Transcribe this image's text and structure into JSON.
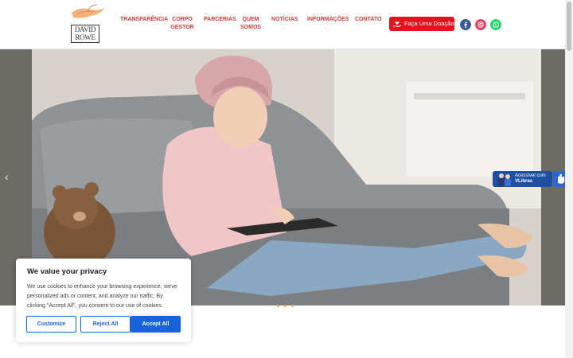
{
  "logo": {
    "line1": "DAVID",
    "line2": "ROWE"
  },
  "nav": [
    {
      "label": "TRANSPARÊNCIA",
      "dot": ""
    },
    {
      "label": "CORPO\nGESTOR",
      "dot": ""
    },
    {
      "label": "PARCERIAS",
      "dot": ""
    },
    {
      "label": "QUEM\nSOMOS",
      "dot": ""
    },
    {
      "label": "NOTÍCIAS",
      "dot": "."
    },
    {
      "label": "INFORMAÇÕES",
      "dot": "."
    },
    {
      "label": "CONTATO",
      "dot": ""
    }
  ],
  "donate": {
    "label": "Faça Uma Doação"
  },
  "social": [
    {
      "icon": "facebook-icon",
      "color": "#3b5998"
    },
    {
      "icon": "instagram-icon",
      "color": "#e4405f"
    },
    {
      "icon": "whatsapp-icon",
      "color": "#25d366"
    }
  ],
  "slider": {
    "prev_arrow": "‹",
    "slides": 3,
    "active": 1
  },
  "vlibras": {
    "line1": "Acessível com",
    "line2": "VLibras"
  },
  "cookie": {
    "title": "We value your privacy",
    "text": "We use cookies to enhance your browsing experience, serve personalized ads or content, and analyze our traffic. By clicking \"Accept All\", you consent to our use of cookies.",
    "customize": "Customize",
    "reject": "Reject All",
    "accept": "Accept All"
  },
  "colors": {
    "accent": "#d33a3a",
    "donate": "#e3141e",
    "cookie_button": "#1863dc",
    "slider_dot": "#e7b243"
  }
}
